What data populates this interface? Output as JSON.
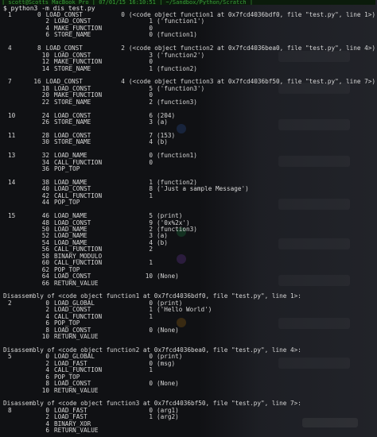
{
  "terminal": {
    "titlebar_text": "| scott@Scotts MacBook Pro | 07/01/15 16:10:51 | ~/Sandbox/Python/Scratch |",
    "prompt_symbol": "$",
    "command": "python3 -m dis test.py"
  },
  "blocks": [
    {
      "rows": [
        {
          "line": "1",
          "off": "0",
          "op": "LOAD_CONST",
          "arg": "0",
          "repr": "(<code object function1 at 0x7fcd4036bdf0, file \"test.py\", line 1>)"
        },
        {
          "line": "",
          "off": "2",
          "op": "LOAD_CONST",
          "arg": "1",
          "repr": "('function1')"
        },
        {
          "line": "",
          "off": "4",
          "op": "MAKE_FUNCTION",
          "arg": "0",
          "repr": ""
        },
        {
          "line": "",
          "off": "6",
          "op": "STORE_NAME",
          "arg": "0",
          "repr": "(function1)"
        }
      ]
    },
    {
      "rows": [
        {
          "line": "4",
          "off": "8",
          "op": "LOAD_CONST",
          "arg": "2",
          "repr": "(<code object function2 at 0x7fcd4036bea0, file \"test.py\", line 4>)"
        },
        {
          "line": "",
          "off": "10",
          "op": "LOAD_CONST",
          "arg": "3",
          "repr": "('function2')"
        },
        {
          "line": "",
          "off": "12",
          "op": "MAKE_FUNCTION",
          "arg": "0",
          "repr": ""
        },
        {
          "line": "",
          "off": "14",
          "op": "STORE_NAME",
          "arg": "1",
          "repr": "(function2)"
        }
      ]
    },
    {
      "rows": [
        {
          "line": "7",
          "off": "16",
          "op": "LOAD_CONST",
          "arg": "4",
          "repr": "(<code object function3 at 0x7fcd4036bf50, file \"test.py\", line 7>)"
        },
        {
          "line": "",
          "off": "18",
          "op": "LOAD_CONST",
          "arg": "5",
          "repr": "('function3')"
        },
        {
          "line": "",
          "off": "20",
          "op": "MAKE_FUNCTION",
          "arg": "0",
          "repr": ""
        },
        {
          "line": "",
          "off": "22",
          "op": "STORE_NAME",
          "arg": "2",
          "repr": "(function3)"
        }
      ]
    },
    {
      "rows": [
        {
          "line": "10",
          "off": "24",
          "op": "LOAD_CONST",
          "arg": "6",
          "repr": "(204)"
        },
        {
          "line": "",
          "off": "26",
          "op": "STORE_NAME",
          "arg": "3",
          "repr": "(a)"
        }
      ]
    },
    {
      "rows": [
        {
          "line": "11",
          "off": "28",
          "op": "LOAD_CONST",
          "arg": "7",
          "repr": "(153)"
        },
        {
          "line": "",
          "off": "30",
          "op": "STORE_NAME",
          "arg": "4",
          "repr": "(b)"
        }
      ]
    },
    {
      "rows": [
        {
          "line": "13",
          "off": "32",
          "op": "LOAD_NAME",
          "arg": "0",
          "repr": "(function1)"
        },
        {
          "line": "",
          "off": "34",
          "op": "CALL_FUNCTION",
          "arg": "0",
          "repr": ""
        },
        {
          "line": "",
          "off": "36",
          "op": "POP_TOP",
          "arg": "",
          "repr": ""
        }
      ]
    },
    {
      "rows": [
        {
          "line": "14",
          "off": "38",
          "op": "LOAD_NAME",
          "arg": "1",
          "repr": "(function2)"
        },
        {
          "line": "",
          "off": "40",
          "op": "LOAD_CONST",
          "arg": "8",
          "repr": "('Just a sample Message')"
        },
        {
          "line": "",
          "off": "42",
          "op": "CALL_FUNCTION",
          "arg": "1",
          "repr": ""
        },
        {
          "line": "",
          "off": "44",
          "op": "POP_TOP",
          "arg": "",
          "repr": ""
        }
      ]
    },
    {
      "rows": [
        {
          "line": "15",
          "off": "46",
          "op": "LOAD_NAME",
          "arg": "5",
          "repr": "(print)"
        },
        {
          "line": "",
          "off": "48",
          "op": "LOAD_CONST",
          "arg": "9",
          "repr": "('0x%2x')"
        },
        {
          "line": "",
          "off": "50",
          "op": "LOAD_NAME",
          "arg": "2",
          "repr": "(function3)"
        },
        {
          "line": "",
          "off": "52",
          "op": "LOAD_NAME",
          "arg": "3",
          "repr": "(a)"
        },
        {
          "line": "",
          "off": "54",
          "op": "LOAD_NAME",
          "arg": "4",
          "repr": "(b)"
        },
        {
          "line": "",
          "off": "56",
          "op": "CALL_FUNCTION",
          "arg": "2",
          "repr": ""
        },
        {
          "line": "",
          "off": "58",
          "op": "BINARY_MODULO",
          "arg": "",
          "repr": ""
        },
        {
          "line": "",
          "off": "60",
          "op": "CALL_FUNCTION",
          "arg": "1",
          "repr": ""
        },
        {
          "line": "",
          "off": "62",
          "op": "POP_TOP",
          "arg": "",
          "repr": ""
        },
        {
          "line": "",
          "off": "64",
          "op": "LOAD_CONST",
          "arg": "10",
          "repr": "(None)"
        },
        {
          "line": "",
          "off": "66",
          "op": "RETURN_VALUE",
          "arg": "",
          "repr": ""
        }
      ]
    }
  ],
  "disassemblies": [
    {
      "header": "Disassembly of <code object function1 at 0x7fcd4036bdf0, file \"test.py\", line 1>:",
      "rows": [
        {
          "line": "2",
          "off": "0",
          "op": "LOAD_GLOBAL",
          "arg": "0",
          "repr": "(print)"
        },
        {
          "line": "",
          "off": "2",
          "op": "LOAD_CONST",
          "arg": "1",
          "repr": "('Hello World')"
        },
        {
          "line": "",
          "off": "4",
          "op": "CALL_FUNCTION",
          "arg": "1",
          "repr": ""
        },
        {
          "line": "",
          "off": "6",
          "op": "POP_TOP",
          "arg": "",
          "repr": ""
        },
        {
          "line": "",
          "off": "8",
          "op": "LOAD_CONST",
          "arg": "0",
          "repr": "(None)"
        },
        {
          "line": "",
          "off": "10",
          "op": "RETURN_VALUE",
          "arg": "",
          "repr": ""
        }
      ]
    },
    {
      "header": "Disassembly of <code object function2 at 0x7fcd4036bea0, file \"test.py\", line 4>:",
      "rows": [
        {
          "line": "5",
          "off": "0",
          "op": "LOAD_GLOBAL",
          "arg": "0",
          "repr": "(print)"
        },
        {
          "line": "",
          "off": "2",
          "op": "LOAD_FAST",
          "arg": "0",
          "repr": "(msg)"
        },
        {
          "line": "",
          "off": "4",
          "op": "CALL_FUNCTION",
          "arg": "1",
          "repr": ""
        },
        {
          "line": "",
          "off": "6",
          "op": "POP_TOP",
          "arg": "",
          "repr": ""
        },
        {
          "line": "",
          "off": "8",
          "op": "LOAD_CONST",
          "arg": "0",
          "repr": "(None)"
        },
        {
          "line": "",
          "off": "10",
          "op": "RETURN_VALUE",
          "arg": "",
          "repr": ""
        }
      ]
    },
    {
      "header": "Disassembly of <code object function3 at 0x7fcd4036bf50, file \"test.py\", line 7>:",
      "rows": [
        {
          "line": "8",
          "off": "0",
          "op": "LOAD_FAST",
          "arg": "0",
          "repr": "(arg1)"
        },
        {
          "line": "",
          "off": "2",
          "op": "LOAD_FAST",
          "arg": "1",
          "repr": "(arg2)"
        },
        {
          "line": "",
          "off": "4",
          "op": "BINARY_XOR",
          "arg": "",
          "repr": ""
        },
        {
          "line": "",
          "off": "6",
          "op": "RETURN_VALUE",
          "arg": "",
          "repr": ""
        }
      ]
    }
  ],
  "colors": {
    "background": "#101114",
    "text": "#d7d7d7",
    "titlebar_text": "#3aa13a"
  }
}
